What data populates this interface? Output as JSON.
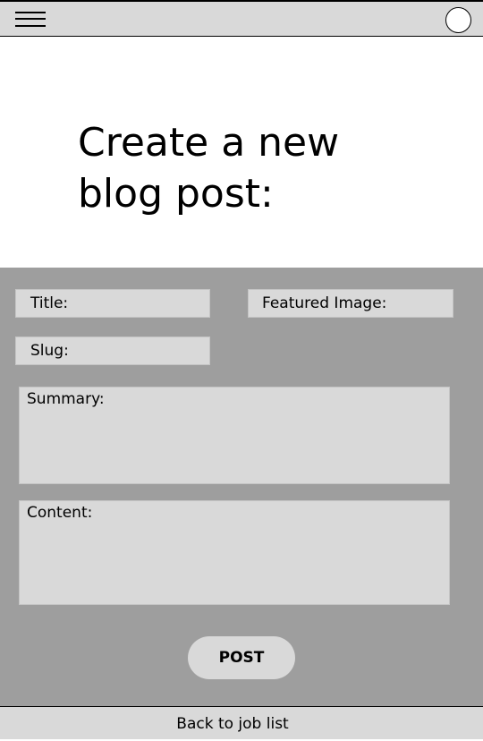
{
  "page": {
    "title": "Create a new blog post:"
  },
  "header": {
    "menu_icon": "hamburger-menu-icon",
    "avatar_icon": "user-avatar-circle"
  },
  "form": {
    "title_label": "Title:",
    "featured_image_label": "Featured Image:",
    "slug_label": "Slug:",
    "summary_label": "Summary:",
    "content_label": "Content:",
    "post_button_label": "POST"
  },
  "footer": {
    "back_link_label": "Back to job list"
  },
  "colors": {
    "bar_background": "#d9d9d9",
    "form_panel_background": "#9e9e9e",
    "field_background": "#d9d9d9",
    "page_background": "#ffffff"
  }
}
